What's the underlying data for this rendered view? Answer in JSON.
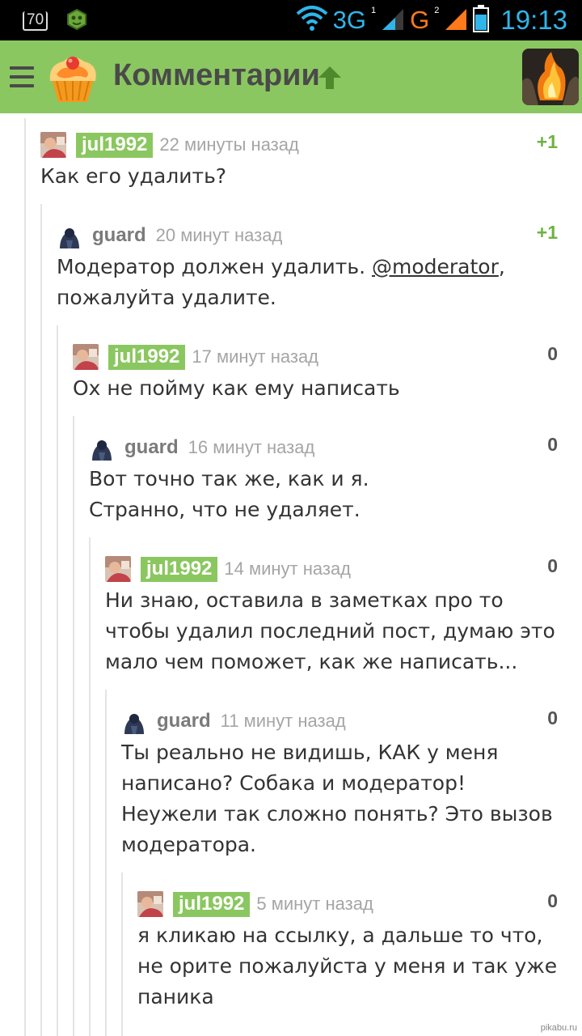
{
  "status_bar": {
    "badge": "70",
    "network_3g": "3G",
    "sim1": "1",
    "network_g": "G",
    "sim2": "2",
    "time": "19:13"
  },
  "app_bar": {
    "title": "Комментарии"
  },
  "comments": [
    {
      "user": "jul1992",
      "highlight": true,
      "time": "22 минуты назад",
      "rating": "+1",
      "text_before": "Как его удалить?",
      "mention": "",
      "text_after": ""
    },
    {
      "user": "guard",
      "highlight": false,
      "time": "20 минут назад",
      "rating": "+1",
      "text_before": "Модератор должен удалить. ",
      "mention": "@moderator",
      "text_after": ",\n пожалуйта удалите."
    },
    {
      "user": "jul1992",
      "highlight": true,
      "time": "17 минут назад",
      "rating": "0",
      "text_before": "Ох не пойму как ему написать",
      "mention": "",
      "text_after": ""
    },
    {
      "user": "guard",
      "highlight": false,
      "time": "16 минут назад",
      "rating": "0",
      "text_before": "Вот точно так же, как и я.\nСтранно, что не удаляет.",
      "mention": "",
      "text_after": ""
    },
    {
      "user": "jul1992",
      "highlight": true,
      "time": "14 минут назад",
      "rating": "0",
      "text_before": "Ни знаю, оставила в заметках про то\nчтобы удалил последний пост, думаю это\nмало чем поможет, как же написать...",
      "mention": "",
      "text_after": ""
    },
    {
      "user": "guard",
      "highlight": false,
      "time": "11 минут назад",
      "rating": "0",
      "text_before": "Ты реально не видишь, КАК у меня\nнаписано? Собака и модератор!\nНеужели так сложно понять? Это вызов\nмодератора.",
      "mention": "",
      "text_after": ""
    },
    {
      "user": "jul1992",
      "highlight": true,
      "time": "5 минут назад",
      "rating": "0",
      "text_before": "я кликаю на ссылку, а дальше то что,\nне орите пожалуйста у меня и так уже\nпаника",
      "mention": "",
      "text_after": ""
    }
  ],
  "watermark": "pikabu.ru"
}
